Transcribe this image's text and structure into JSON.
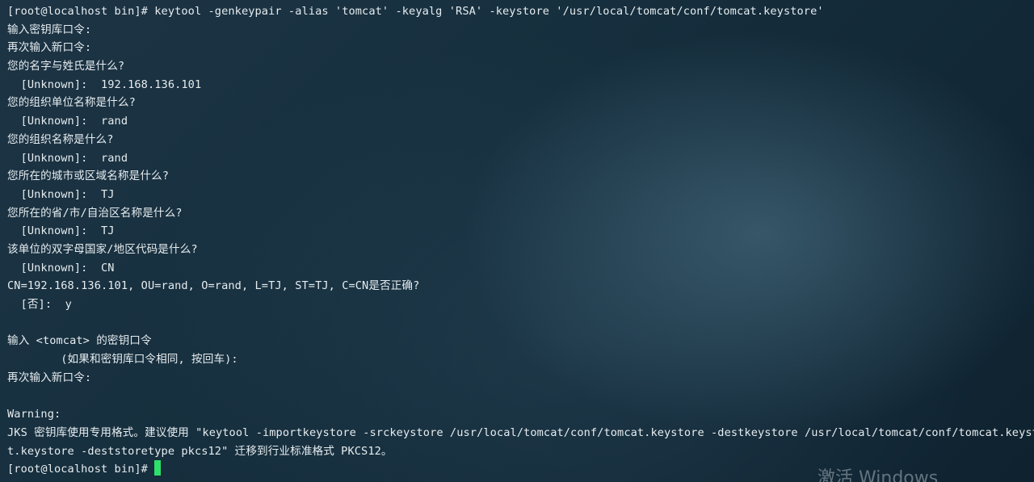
{
  "terminal": {
    "lines": [
      "[root@localhost bin]# keytool -genkeypair -alias 'tomcat' -keyalg 'RSA' -keystore '/usr/local/tomcat/conf/tomcat.keystore'",
      "输入密钥库口令:",
      "再次输入新口令:",
      "您的名字与姓氏是什么?",
      "  [Unknown]:  192.168.136.101",
      "您的组织单位名称是什么?",
      "  [Unknown]:  rand",
      "您的组织名称是什么?",
      "  [Unknown]:  rand",
      "您所在的城市或区域名称是什么?",
      "  [Unknown]:  TJ",
      "您所在的省/市/自治区名称是什么?",
      "  [Unknown]:  TJ",
      "该单位的双字母国家/地区代码是什么?",
      "  [Unknown]:  CN",
      "CN=192.168.136.101, OU=rand, O=rand, L=TJ, ST=TJ, C=CN是否正确?",
      "  [否]:  y",
      "",
      "输入 <tomcat> 的密钥口令",
      "        (如果和密钥库口令相同, 按回车):",
      "再次输入新口令:",
      "",
      "Warning:",
      "JKS 密钥库使用专用格式。建议使用 \"keytool -importkeystore -srckeystore /usr/local/tomcat/conf/tomcat.keystore -destkeystore /usr/local/tomcat/conf/tomcat.keystore -deststoretype pkcs12\" 迁移到行业标准格式 PKCS12。"
    ],
    "wrapped_tail": "t.keystore -deststoretype pkcs12\" 迁移到行业标准格式 PKCS12。",
    "final_prompt": "[root@localhost bin]# ",
    "cursor_color": "#2de06a"
  },
  "watermark": {
    "text": "激活 Windows"
  }
}
